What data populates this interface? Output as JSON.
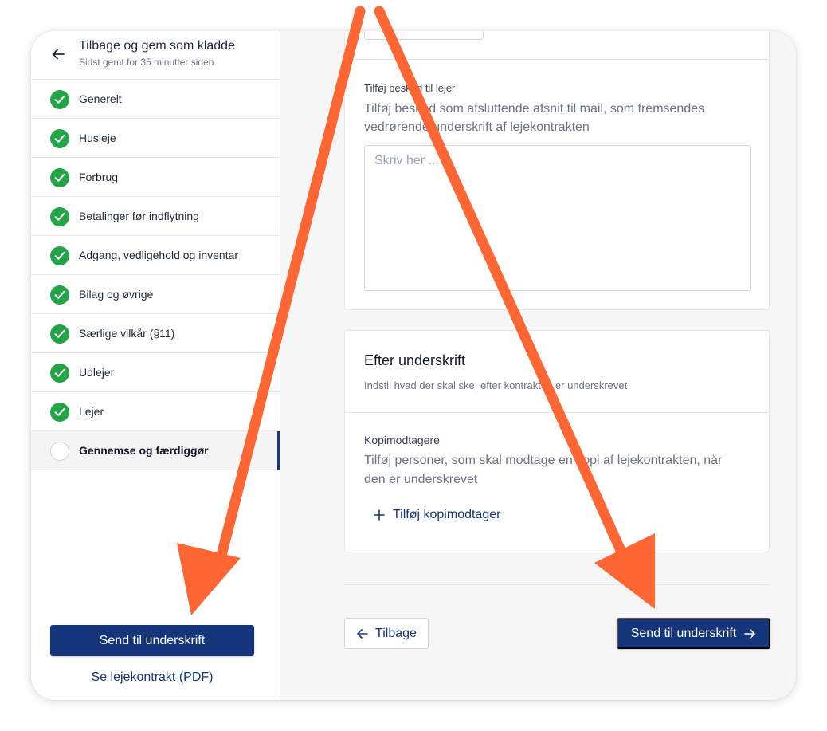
{
  "sidebar": {
    "back_title": "Tilbage og gem som kladde",
    "saved_status": "Sidst gemt for 35 minutter siden",
    "steps": [
      {
        "label": "Generelt",
        "done": true
      },
      {
        "label": "Husleje",
        "done": true
      },
      {
        "label": "Forbrug",
        "done": true
      },
      {
        "label": "Betalinger før indflytning",
        "done": true
      },
      {
        "label": "Adgang, vedligehold og inventar",
        "done": true
      },
      {
        "label": "Bilag og øvrige",
        "done": true
      },
      {
        "label": "Særlige vilkår (§11)",
        "done": true
      },
      {
        "label": "Udlejer",
        "done": true
      },
      {
        "label": "Lejer",
        "done": true
      },
      {
        "label": "Gennemse og færdiggør",
        "done": false,
        "active": true
      }
    ],
    "send_button": "Send til underskrift",
    "pdf_link": "Se lejekontrakt (PDF)"
  },
  "message": {
    "label": "Tilføj besked til lejer",
    "help": "Tilføj besked som afsluttende afsnit til mail, som fremsendes vedrørende underskrift af lejekontrakten",
    "placeholder": "Skriv her ..."
  },
  "after_signing": {
    "title": "Efter underskrift",
    "subtitle": "Indstil hvad der skal ske, efter kontrakten er underskrevet",
    "copy_label": "Kopimodtagere",
    "copy_help": "Tilføj personer, som skal modtage en kopi af lejekontrakten, når den er underskrevet",
    "add_copy": "Tilføj kopimodtager"
  },
  "footer": {
    "back_button": "Tilbage",
    "send_button": "Send til underskrift"
  },
  "colors": {
    "primary": "#15357a",
    "success": "#22a447",
    "annotation": "#ff6633"
  }
}
